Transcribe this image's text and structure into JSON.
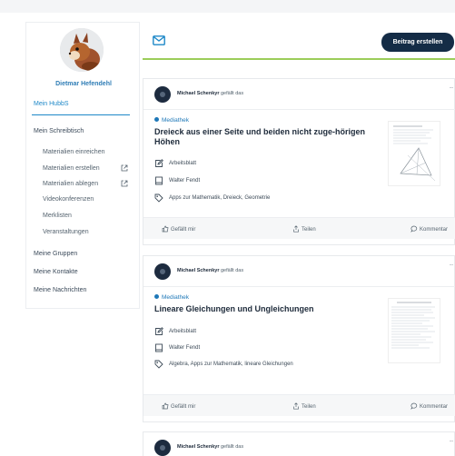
{
  "profile": {
    "name": "Dietmar Hefendehl"
  },
  "nav": {
    "active": "Mein HubbS",
    "schreibtisch": "Mein Schreibtisch",
    "sub": [
      {
        "label": "Materialien einreichen",
        "external": false
      },
      {
        "label": "Materialien erstellen",
        "external": true
      },
      {
        "label": "Materialien ablegen",
        "external": true
      },
      {
        "label": "Videokonferenzen",
        "external": false
      },
      {
        "label": "Merklisten",
        "external": false
      },
      {
        "label": "Veranstaltungen",
        "external": false
      }
    ],
    "groups": "Meine Gruppen",
    "contacts": "Meine Kontakte",
    "messages": "Meine Nachrichten"
  },
  "compose": {
    "post_label": "Beitrag erstellen"
  },
  "posts": [
    {
      "liker_name": "Michael Schenkyr",
      "liker_suffix": "gefällt das",
      "category": "Mediathek",
      "title": "Dreieck aus einer Seite und beiden nicht zuge-hörigen Höhen",
      "type": "Arbeitsblatt",
      "author": "Walter Fendt",
      "tags": "Apps zur Mathematik, Dreieck, Geometrie"
    },
    {
      "liker_name": "Michael Schenkyr",
      "liker_suffix": "gefällt das",
      "category": "Mediathek",
      "title": "Lineare Gleichungen und Ungleichungen",
      "type": "Arbeitsblatt",
      "author": "Walter Fendt",
      "tags": "Algebra, Apps zur Mathematik, lineare Gleichungen"
    },
    {
      "liker_name": "Michael Schenkyr",
      "liker_suffix": "gefällt das"
    }
  ],
  "actions": {
    "like": "Gefällt mir",
    "share": "Teilen",
    "comment": "Kommentar"
  },
  "more_glyph": "...",
  "colors": {
    "accent": "#1e88c8",
    "navy": "#142c46",
    "green": "#9ccd5a"
  }
}
